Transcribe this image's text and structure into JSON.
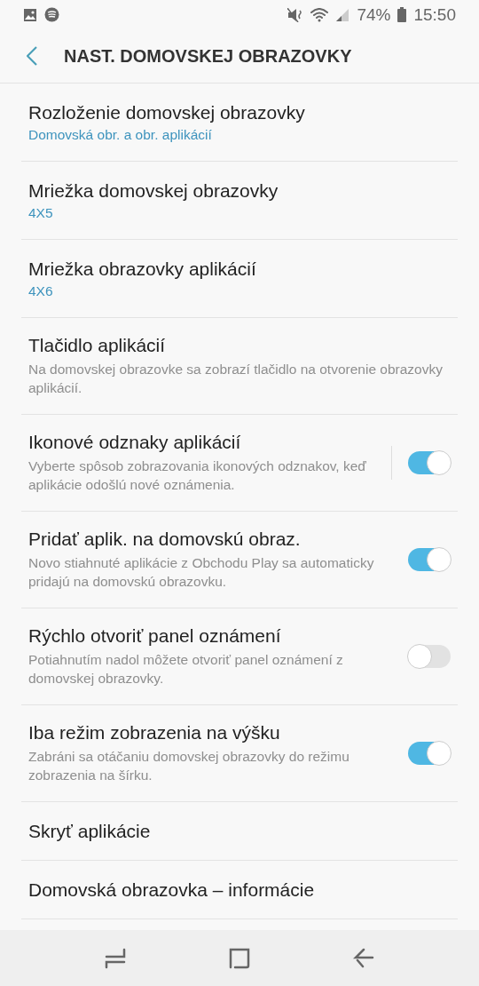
{
  "status_bar": {
    "battery": "74%",
    "time": "15:50"
  },
  "header": {
    "title": "NAST. DOMOVSKEJ OBRAZOVKY"
  },
  "items": [
    {
      "kind": "value",
      "title": "Rozloženie domovskej obrazovky",
      "value": "Domovská obr. a obr. aplikácií"
    },
    {
      "kind": "value",
      "title": "Mriežka domovskej obrazovky",
      "value": "4X5"
    },
    {
      "kind": "value",
      "title": "Mriežka obrazovky aplikácií",
      "value": "4X6"
    },
    {
      "kind": "info",
      "title": "Tlačidlo aplikácií",
      "description": "Na domovskej obrazovke sa zobrazí tlačidlo na otvorenie obrazovky aplikácií."
    },
    {
      "kind": "toggle",
      "title": "Ikonové odznaky aplikácií",
      "description": "Vyberte spôsob zobrazovania ikonových odznakov, keď aplikácie odošlú nové oznámenia.",
      "on": true,
      "split": true
    },
    {
      "kind": "toggle",
      "title": "Pridať aplik. na domovskú obraz.",
      "description": "Novo stiahnuté aplikácie z Obchodu Play sa automaticky pridajú na domovskú obrazovku.",
      "on": true,
      "split": false
    },
    {
      "kind": "toggle",
      "title": "Rýchlo otvoriť panel oznámení",
      "description": "Potiahnutím nadol môžete otvoriť panel oznámení z domovskej obrazovky.",
      "on": false,
      "split": false
    },
    {
      "kind": "toggle",
      "title": "Iba režim zobrazenia na výšku",
      "description": "Zabráni sa otáčaniu domovskej obrazovky do režimu zobrazenia na šírku.",
      "on": true,
      "split": false
    },
    {
      "kind": "plain",
      "title": "Skryť aplikácie"
    },
    {
      "kind": "plain",
      "title": "Domovská obrazovka – informácie"
    }
  ]
}
